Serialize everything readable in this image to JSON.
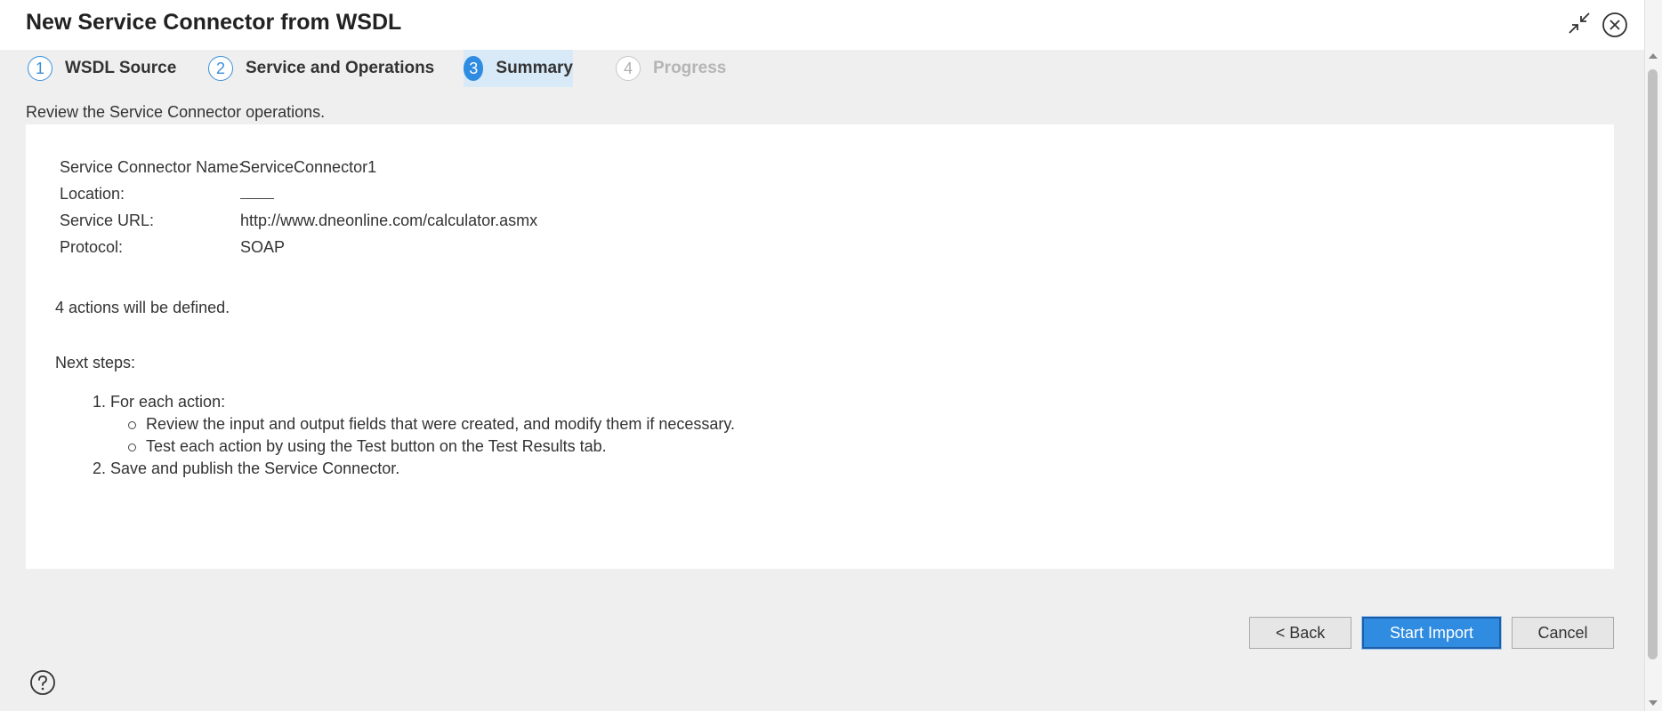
{
  "dialog": {
    "title": "New Service Connector from WSDL"
  },
  "steps": [
    {
      "number": "1",
      "label": "WSDL Source",
      "state": "done"
    },
    {
      "number": "2",
      "label": "Service and Operations",
      "state": "done"
    },
    {
      "number": "3",
      "label": "Summary",
      "state": "active"
    },
    {
      "number": "4",
      "label": "Progress",
      "state": "disabled"
    }
  ],
  "summary": {
    "subtitle": "Review the Service Connector operations.",
    "fields": [
      {
        "key": "Service Connector Name:",
        "value": "ServiceConnector1"
      },
      {
        "key": "Location:",
        "value": ""
      },
      {
        "key": "Service URL:",
        "value": "http://www.dneonline.com/calculator.asmx"
      },
      {
        "key": "Protocol:",
        "value": "SOAP"
      }
    ],
    "actions_count": "4 actions will be defined.",
    "next_steps_label": "Next steps:",
    "next_steps": {
      "item1": "1. For each action:",
      "item1_sub1": "Review the input and output fields that were created, and modify them if necessary.",
      "item1_sub2": "Test each action by using the Test button on the Test Results tab.",
      "item2": "2. Save and publish the Service Connector."
    }
  },
  "buttons": {
    "back": "< Back",
    "start_import": "Start Import",
    "cancel": "Cancel"
  },
  "icons": {
    "collapse": "collapse-arrows-icon",
    "close": "close-circle-icon",
    "help": "help-circle-icon"
  },
  "colors": {
    "accent": "#2f8ce0",
    "active_step_bg": "#d8e9f7",
    "disabled_text": "#b5b5b5"
  }
}
